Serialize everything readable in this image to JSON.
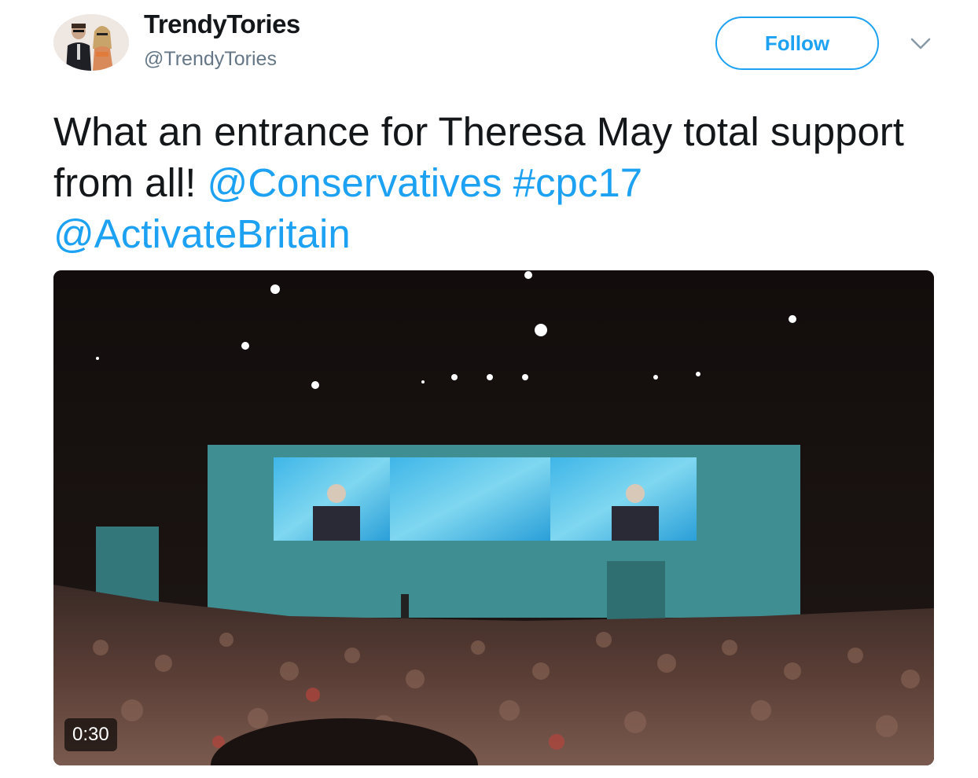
{
  "user": {
    "display_name": "TrendyTories",
    "handle": "@TrendyTories"
  },
  "actions": {
    "follow_label": "Follow",
    "more_icon": "chevron-down-icon"
  },
  "tweet": {
    "text_plain": "What an entrance for Theresa May total support from all! ",
    "mention_1": "@Conservatives",
    "hashtag": "#cpc17",
    "mention_2": "@ActivateBritain"
  },
  "media": {
    "type": "video",
    "duration": "0:30"
  },
  "colors": {
    "link": "#1da1f2",
    "text": "#14171a",
    "secondary": "#657786",
    "stage": "#3f8f92"
  }
}
